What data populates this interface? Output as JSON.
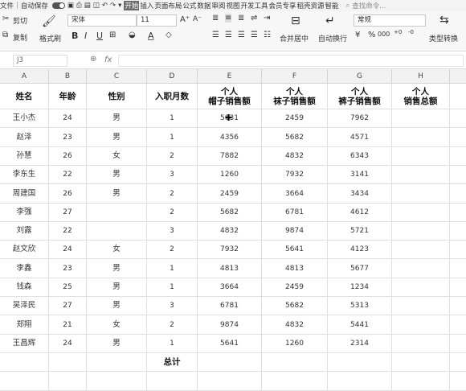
{
  "menubar": {
    "file_label": "文件",
    "autosave_label": "自动保存",
    "tabs": [
      "开始",
      "插入",
      "页面布局",
      "公式",
      "数据",
      "审阅",
      "视图",
      "开发工具",
      "会员专享",
      "稻壳资源",
      "智能"
    ],
    "search_placeholder": "查找命令..."
  },
  "toolbar": {
    "cut_label": "剪切",
    "copy_label": "复制",
    "format_painter_label": "格式刷",
    "font_name": "宋体",
    "font_size": "11",
    "merge_label": "合并居中",
    "wrap_label": "自动换行",
    "number_format": "常规",
    "convert_label": "类型转换"
  },
  "formula_bar": {
    "name_box": "J3",
    "fx_label": "fx",
    "value": ""
  },
  "columns": [
    "A",
    "B",
    "C",
    "D",
    "E",
    "F",
    "G",
    "H"
  ],
  "header": {
    "name": "姓名",
    "age": "年龄",
    "gender": "性别",
    "month": "入职月数",
    "hat_line1": "个人",
    "hat_line2": "帽子销售额",
    "sock_line1": "个人",
    "sock_line2": "袜子销售额",
    "pants_line1": "个人",
    "pants_line2": "裤子销售额",
    "total_line1": "个人",
    "total_line2": "销售总额"
  },
  "rows": [
    {
      "name": "王小杰",
      "age": "24",
      "gender": "男",
      "month": "1",
      "hat": "5631",
      "sock": "2459",
      "pants": "7962"
    },
    {
      "name": "赵泽",
      "age": "23",
      "gender": "男",
      "month": "1",
      "hat": "4356",
      "sock": "5682",
      "pants": "4571"
    },
    {
      "name": "孙慧",
      "age": "26",
      "gender": "女",
      "month": "2",
      "hat": "7882",
      "sock": "4832",
      "pants": "6343"
    },
    {
      "name": "李东生",
      "age": "22",
      "gender": "男",
      "month": "3",
      "hat": "1260",
      "sock": "7932",
      "pants": "3141"
    },
    {
      "name": "周建国",
      "age": "26",
      "gender": "男",
      "month": "2",
      "hat": "2459",
      "sock": "3664",
      "pants": "3434"
    },
    {
      "name": "李强",
      "age": "27",
      "gender": "",
      "month": "2",
      "hat": "5682",
      "sock": "6781",
      "pants": "4612"
    },
    {
      "name": "刘露",
      "age": "22",
      "gender": "",
      "month": "3",
      "hat": "4832",
      "sock": "9874",
      "pants": "5721"
    },
    {
      "name": "赵文欣",
      "age": "24",
      "gender": "女",
      "month": "2",
      "hat": "7932",
      "sock": "5641",
      "pants": "4123"
    },
    {
      "name": "李鑫",
      "age": "23",
      "gender": "男",
      "month": "1",
      "hat": "4813",
      "sock": "4813",
      "pants": "5677"
    },
    {
      "name": "钱森",
      "age": "25",
      "gender": "男",
      "month": "1",
      "hat": "3664",
      "sock": "2459",
      "pants": "1234"
    },
    {
      "name": "吴泽民",
      "age": "27",
      "gender": "男",
      "month": "3",
      "hat": "6781",
      "sock": "5682",
      "pants": "5313"
    },
    {
      "name": "郑翔",
      "age": "21",
      "gender": "女",
      "month": "2",
      "hat": "9874",
      "sock": "4832",
      "pants": "5441"
    },
    {
      "name": "王昌辉",
      "age": "24",
      "gender": "男",
      "month": "1",
      "hat": "5641",
      "sock": "1260",
      "pants": "2314"
    }
  ],
  "total_label": "总计"
}
